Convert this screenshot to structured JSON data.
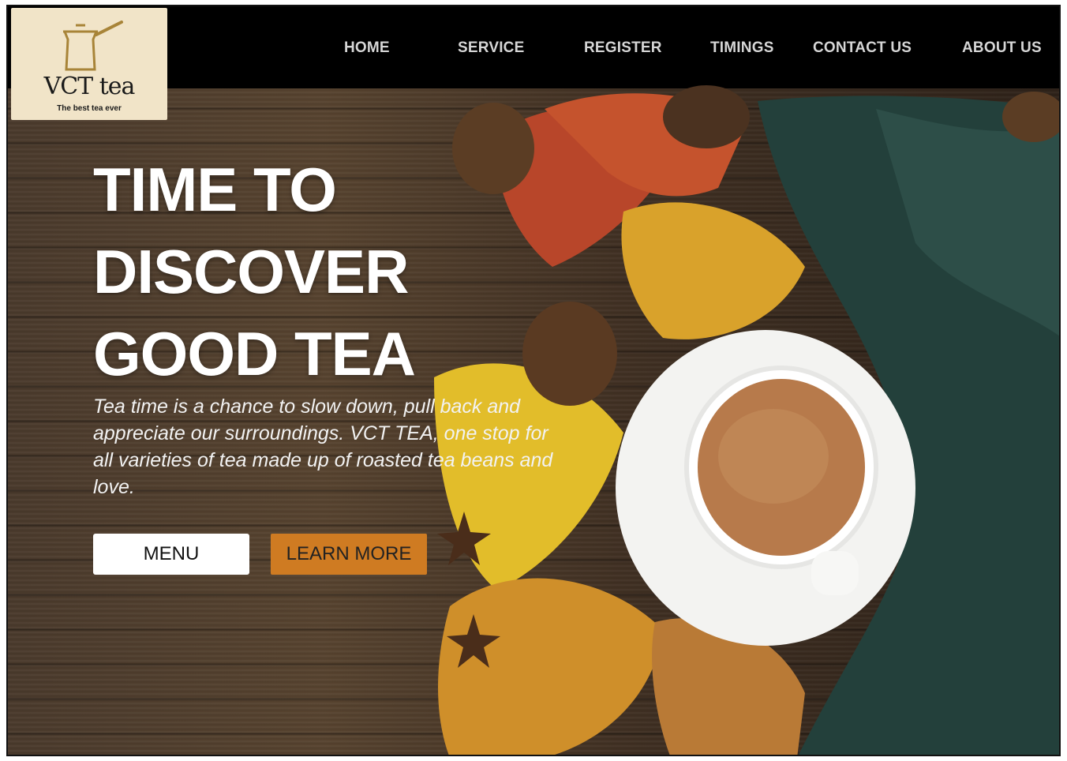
{
  "brand": {
    "name": "VCT tea",
    "tagline": "The best tea ever",
    "icon": "teapot-icon"
  },
  "nav": {
    "items": [
      {
        "label": "HOME"
      },
      {
        "label": "SERVICE"
      },
      {
        "label": "REGISTER"
      },
      {
        "label": "TIMINGS"
      },
      {
        "label": "CONTACT US"
      },
      {
        "label": "ABOUT US"
      }
    ]
  },
  "hero": {
    "headline_lines": [
      "TIME TO",
      "DISCOVER",
      "GOOD TEA"
    ],
    "description": "Tea time is a chance to slow down, pull back and appreciate our surroundings.  VCT TEA, one stop for all varieties of tea made up of roasted tea beans and love.",
    "buttons": {
      "menu": "MENU",
      "learn_more": "LEARN MORE"
    }
  },
  "colors": {
    "nav_background": "#000000",
    "accent": "#cf7b22",
    "logo_background": "#f1e4c8"
  }
}
